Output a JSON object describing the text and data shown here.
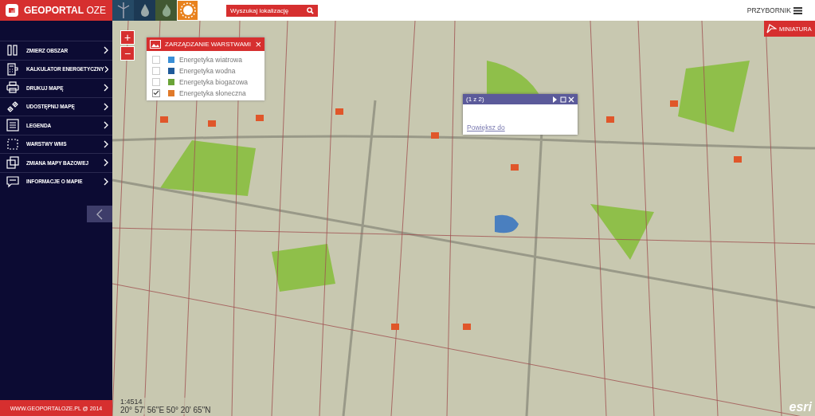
{
  "header": {
    "logo": "GEOPORTAL",
    "logo_suffix": "OZE",
    "energy_tabs": [
      {
        "kind": "wind",
        "color": "#1d4a6e",
        "selected": false
      },
      {
        "kind": "water",
        "color": "#163a5c",
        "selected": false
      },
      {
        "kind": "biogas",
        "color": "#3d5a2a",
        "selected": false
      },
      {
        "kind": "solar",
        "color": "#e8821e",
        "selected": true
      }
    ],
    "search": {
      "placeholder": "Wyszukaj lokalizację"
    },
    "toolbox": "PRZYBORNIK"
  },
  "sidebar": {
    "items": [
      {
        "kind": "measure",
        "label": "ZMIERZ OBSZAR"
      },
      {
        "kind": "calculator",
        "label": "KALKULATOR ENERGETYCZNY"
      },
      {
        "kind": "print",
        "label": "DRUKUJ MAPĘ"
      },
      {
        "kind": "link",
        "label": "UDOSTĘPNIJ MAPĘ"
      },
      {
        "kind": "legend",
        "label": "LEGENDA"
      },
      {
        "kind": "wms",
        "label": "WARSTWY WMS"
      },
      {
        "kind": "basemap",
        "label": "ZMIANA MAPY BAZOWEJ"
      },
      {
        "kind": "info",
        "label": "INFORMACJE O MAPIE"
      }
    ],
    "footer": "WWW.GEOPORTALOZE.PL @ 2014"
  },
  "map": {
    "zoom_in": "+",
    "zoom_out": "−",
    "minimap": "MINIATURA",
    "scale": "1:4514",
    "coordinates": "20° 57' 56\"E 50° 20' 65\"N",
    "attribution": "esri",
    "layers_panel": {
      "title": "ZARZĄDZANIE WARSTWAMI",
      "close": "×",
      "layers": [
        {
          "label": "Energetyka wiatrowa",
          "checked": false,
          "color": "#3a8fd6"
        },
        {
          "label": "Energetyka wodna",
          "checked": false,
          "color": "#1f5a9a"
        },
        {
          "label": "Energetyka biogazowa",
          "checked": false,
          "color": "#6aa338"
        },
        {
          "label": "Energetyka słoneczna",
          "checked": true,
          "color": "#e07a2a"
        }
      ]
    },
    "popup": {
      "title": "(1 z 2)",
      "link": "Powiększ do"
    }
  }
}
